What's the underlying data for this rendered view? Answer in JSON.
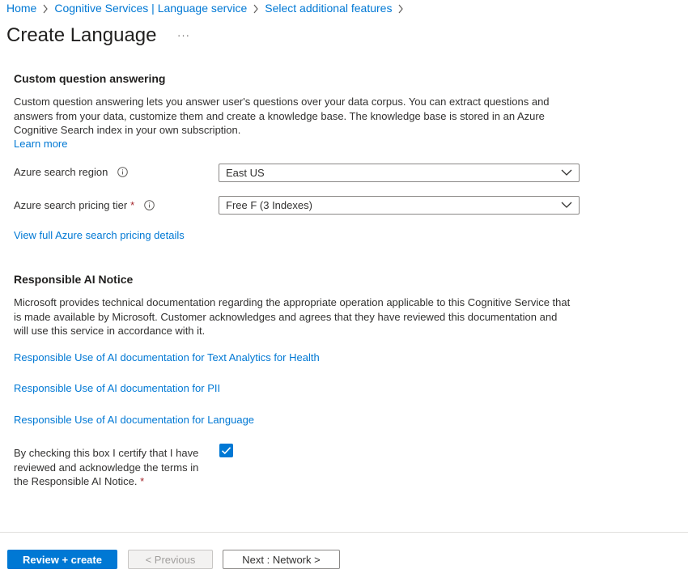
{
  "breadcrumb": {
    "items": [
      "Home",
      "Cognitive Services | Language service",
      "Select additional features"
    ]
  },
  "page": {
    "title": "Create Language",
    "more": "···"
  },
  "cqa": {
    "title": "Custom question answering",
    "description": "Custom question answering lets you answer user's questions over your data corpus. You can extract questions and answers from your data, customize them and create a knowledge base. The knowledge base is stored in an Azure Cognitive Search index in your own subscription.",
    "learn_more": "Learn more",
    "region_label": "Azure search region",
    "region_value": "East US",
    "tier_label": "Azure search pricing tier",
    "tier_required": "*",
    "tier_value": "Free F (3 Indexes)",
    "pricing_link": "View full Azure search pricing details"
  },
  "rai": {
    "title": "Responsible AI Notice",
    "description": "Microsoft provides technical documentation regarding the appropriate operation applicable to this Cognitive Service that is made available by Microsoft. Customer acknowledges and agrees that they have reviewed this documentation and will use this service in accordance with it.",
    "link_health": "Responsible Use of AI documentation for Text Analytics for Health",
    "link_pii": "Responsible Use of AI documentation for PII",
    "link_language": "Responsible Use of AI documentation for Language",
    "certify_text": "By checking this box I certify that I have reviewed and acknowledge the terms in the Responsible AI Notice.",
    "certify_required": "*",
    "certify_checked": true
  },
  "footer": {
    "review_create": "Review + create",
    "previous": "< Previous",
    "next": "Next : Network >"
  },
  "colors": {
    "accent": "#0078d4",
    "required": "#a4262c"
  },
  "icons": [
    "chevron-right-icon",
    "info-icon",
    "chevron-down-icon",
    "checkmark-icon",
    "more-icon"
  ]
}
